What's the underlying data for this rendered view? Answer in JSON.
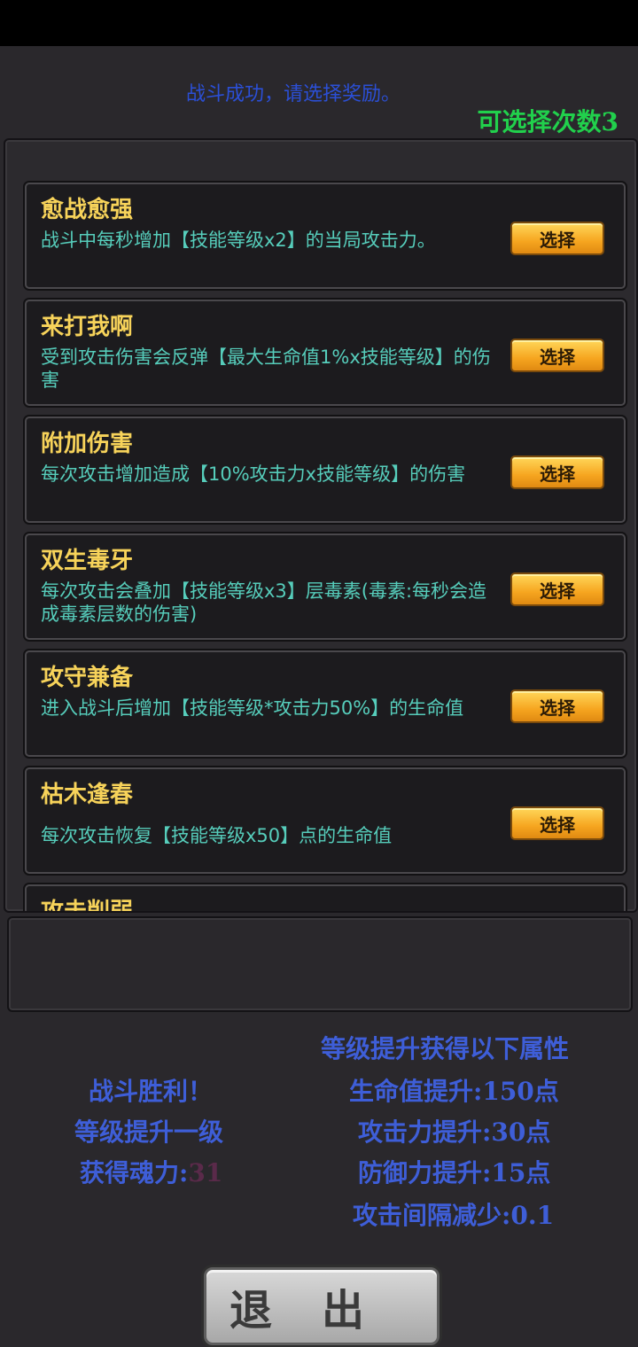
{
  "header": {
    "message": "战斗成功，请选择奖励。",
    "choices_left": "可选择次数3"
  },
  "rewards": [
    {
      "title": "愈战愈强",
      "desc": "战斗中每秒增加【技能等级x2】的当局攻击力。",
      "button": "选择"
    },
    {
      "title": "来打我啊",
      "desc": "受到攻击伤害会反弹【最大生命值1%x技能等级】的伤害",
      "button": "选择"
    },
    {
      "title": "附加伤害",
      "desc": "每次攻击增加造成【10%攻击力x技能等级】的伤害",
      "button": "选择"
    },
    {
      "title": "双生毒牙",
      "desc": "每次攻击会叠加【技能等级x3】层毒素(毒素:每秒会造成毒素层数的伤害)",
      "button": "选择"
    },
    {
      "title": "攻守兼备",
      "desc": "进入战斗后增加【技能等级*攻击力50%】的生命值",
      "button": "选择"
    },
    {
      "title": "枯木逢春",
      "desc": "每次攻击恢复【技能等级x50】点的生命值",
      "button": "选择"
    },
    {
      "title": "攻击削弱",
      "desc": "",
      "button": ""
    }
  ],
  "result": {
    "victory": "战斗胜利！",
    "level_up": "等级提升一级",
    "soul_label": "获得魂力:",
    "soul_value": "31"
  },
  "attributes": {
    "heading": "等级提升获得以下属性",
    "hp": "生命值提升:150点",
    "attack": "攻击力提升:30点",
    "defense": "防御力提升:15点",
    "interval": "攻击间隔减少:0.1"
  },
  "exit_label": "退出"
}
